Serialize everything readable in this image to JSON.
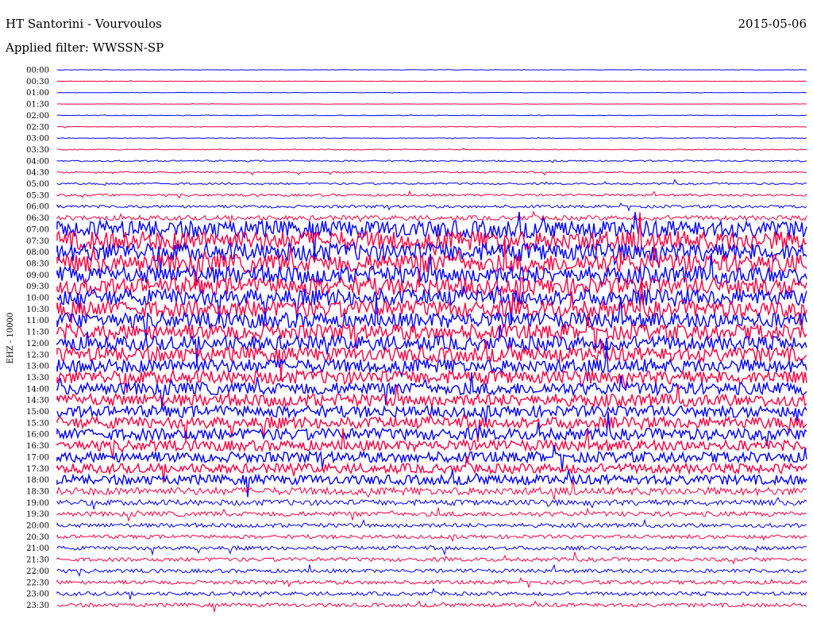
{
  "header": {
    "station": "HT Santorini - Vourvoulos",
    "date": "2015-05-06",
    "filter": "Applied filter: WWSSN-SP"
  },
  "colors": {
    "trace_a": "#0000ff",
    "trace_b": "#ff0040",
    "text": "#000000",
    "background": "#ffffff"
  },
  "chart_data": {
    "type": "line",
    "title": "HT Santorini - Vourvoulos",
    "subtitle": "Applied filter: WWSSN-SP",
    "ylabel": "EHZ - 10000",
    "y_tick_labels": [
      "00:00",
      "00:30",
      "01:00",
      "01:30",
      "02:00",
      "02:30",
      "03:00",
      "03:30",
      "04:00",
      "04:30",
      "05:00",
      "05:30",
      "06:00",
      "06:30",
      "07:00",
      "07:30",
      "08:00",
      "08:30",
      "09:00",
      "09:30",
      "10:00",
      "10:30",
      "11:00",
      "11:30",
      "12:00",
      "12:30",
      "13:00",
      "13:30",
      "14:00",
      "14:30",
      "15:00",
      "15:30",
      "16:00",
      "16:30",
      "17:00",
      "17:30",
      "18:00",
      "18:30",
      "19:00",
      "19:30",
      "20:00",
      "20:30",
      "21:00",
      "21:30",
      "22:00",
      "22:30",
      "23:00",
      "23:30"
    ],
    "trace_colors": [
      "#0000ff",
      "#ff0040"
    ],
    "noise_level": [
      0.02,
      0.02,
      0.02,
      0.02,
      0.03,
      0.03,
      0.03,
      0.05,
      0.08,
      0.08,
      0.1,
      0.12,
      0.15,
      0.25,
      0.9,
      1.0,
      0.95,
      0.95,
      0.9,
      0.9,
      0.85,
      0.85,
      0.8,
      0.8,
      0.75,
      0.75,
      0.7,
      0.7,
      0.65,
      0.65,
      0.6,
      0.6,
      0.6,
      0.55,
      0.55,
      0.5,
      0.5,
      0.4,
      0.3,
      0.25,
      0.22,
      0.2,
      0.2,
      0.2,
      0.2,
      0.2,
      0.2,
      0.2
    ],
    "grid": false,
    "legend": "none"
  }
}
